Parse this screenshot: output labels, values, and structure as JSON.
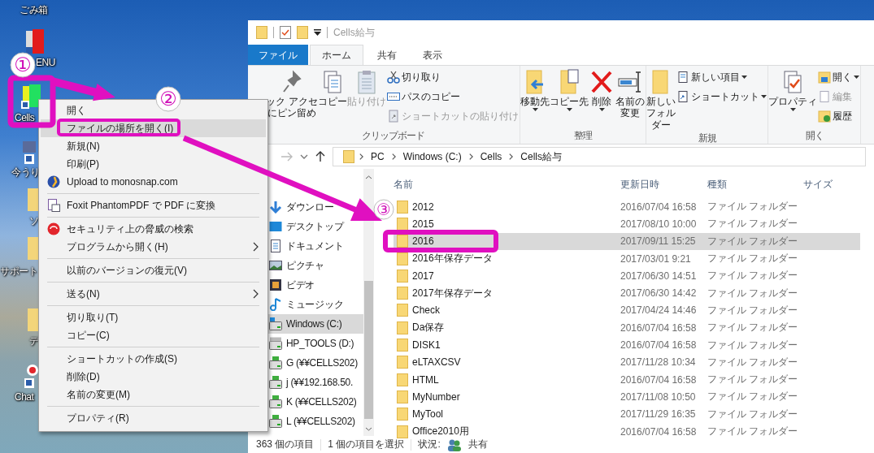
{
  "desktop": {
    "icons": [
      {
        "label": "ごみ箱",
        "kind": "label-only"
      },
      {
        "label": "ENU",
        "kind": "menu-app"
      },
      {
        "label": "Cells",
        "kind": "cells-app"
      },
      {
        "label": "今うり",
        "kind": "tool"
      },
      {
        "label": "ソ",
        "kind": "folder"
      },
      {
        "label": "サポート",
        "kind": "folder"
      },
      {
        "label": "デ",
        "kind": "folder"
      },
      {
        "label": "Chat",
        "kind": "chat-app"
      }
    ]
  },
  "explorer": {
    "title": "Cells給与",
    "tabs": [
      {
        "label": "ファイル",
        "kind": "file",
        "selected": false
      },
      {
        "label": "ホーム",
        "kind": "tab",
        "selected": true
      },
      {
        "label": "共有",
        "kind": "tab",
        "selected": false
      },
      {
        "label": "表示",
        "kind": "tab",
        "selected": false
      }
    ],
    "ribbon": {
      "groups": [
        {
          "label": "クリップボード",
          "large": [
            {
              "label": "ック アクセにピン留め",
              "disabled": false,
              "dropdown": false
            },
            {
              "label": "コピー",
              "disabled": false,
              "dropdown": false
            },
            {
              "label": "貼り付け",
              "disabled": true,
              "dropdown": false
            }
          ],
          "small": [
            {
              "label": "切り取り",
              "disabled": false,
              "dropdown": false
            },
            {
              "label": "パスのコピー",
              "disabled": false,
              "dropdown": false
            },
            {
              "label": "ショートカットの貼り付け",
              "disabled": true,
              "dropdown": false
            }
          ]
        },
        {
          "label": "整理",
          "large": [
            {
              "label": "移動先",
              "disabled": false,
              "dropdown": true
            },
            {
              "label": "コピー先",
              "disabled": false,
              "dropdown": true
            },
            {
              "label": "削除",
              "disabled": false,
              "dropdown": true
            },
            {
              "label": "名前の変更",
              "disabled": false,
              "dropdown": false
            }
          ]
        },
        {
          "label": "新規",
          "large": [
            {
              "label": "新しいフォルダー",
              "disabled": false,
              "dropdown": false
            }
          ],
          "small": [
            {
              "label": "新しい項目",
              "disabled": false,
              "dropdown": true
            },
            {
              "label": "ショートカット",
              "disabled": false,
              "dropdown": true
            }
          ]
        },
        {
          "label": "開く",
          "large": [
            {
              "label": "プロパティ",
              "disabled": false,
              "dropdown": true
            }
          ],
          "small": [
            {
              "label": "開く",
              "disabled": false,
              "dropdown": true
            },
            {
              "label": "編集",
              "disabled": true,
              "dropdown": false
            },
            {
              "label": "履歴",
              "disabled": false,
              "dropdown": false
            }
          ]
        }
      ]
    },
    "address": {
      "crumbs": [
        "PC",
        "Windows (C:)",
        "Cells",
        "Cells給与"
      ]
    },
    "nav": {
      "items": [
        {
          "label": "ダウンロー",
          "kind": "download",
          "selected": false
        },
        {
          "label": "デスクトップ",
          "kind": "desktop",
          "selected": false
        },
        {
          "label": "ドキュメント",
          "kind": "document",
          "selected": false
        },
        {
          "label": "ピクチャ",
          "kind": "picture",
          "selected": false
        },
        {
          "label": "ビデオ",
          "kind": "video",
          "selected": false
        },
        {
          "label": "ミュージック",
          "kind": "music",
          "selected": false
        },
        {
          "label": "Windows (C:)",
          "kind": "system-drive",
          "selected": true
        },
        {
          "label": "HP_TOOLS (D:)",
          "kind": "drive",
          "selected": false
        },
        {
          "label": "G (¥¥CELLS202)",
          "kind": "network-drive",
          "selected": false
        },
        {
          "label": "j (¥¥192.168.50.",
          "kind": "network-drive",
          "selected": false
        },
        {
          "label": "K (¥¥CELLS202)",
          "kind": "network-drive",
          "selected": false
        },
        {
          "label": "L (¥¥CELLS202)",
          "kind": "network-drive",
          "selected": false
        }
      ]
    },
    "files": {
      "columns": [
        "名前",
        "更新日時",
        "種類",
        "サイズ"
      ],
      "rows": [
        {
          "name": "2012",
          "modified": "2016/07/04 16:58",
          "type": "ファイル フォルダー",
          "selected": false
        },
        {
          "name": "2015",
          "modified": "2017/08/10 10:00",
          "type": "ファイル フォルダー",
          "selected": false
        },
        {
          "name": "2016",
          "modified": "2017/09/11 15:25",
          "type": "ファイル フォルダー",
          "selected": true
        },
        {
          "name": "2016年保存データ",
          "modified": "2017/03/01 9:21",
          "type": "ファイル フォルダー",
          "selected": false
        },
        {
          "name": "2017",
          "modified": "2017/06/30 14:51",
          "type": "ファイル フォルダー",
          "selected": false
        },
        {
          "name": "2017年保存データ",
          "modified": "2017/06/30 14:42",
          "type": "ファイル フォルダー",
          "selected": false
        },
        {
          "name": "Check",
          "modified": "2017/04/24 14:46",
          "type": "ファイル フォルダー",
          "selected": false
        },
        {
          "name": "Da保存",
          "modified": "2016/07/04 16:58",
          "type": "ファイル フォルダー",
          "selected": false
        },
        {
          "name": "DISK1",
          "modified": "2016/07/04 16:58",
          "type": "ファイル フォルダー",
          "selected": false
        },
        {
          "name": "eLTAXCSV",
          "modified": "2017/11/28 10:34",
          "type": "ファイル フォルダー",
          "selected": false
        },
        {
          "name": "HTML",
          "modified": "2016/07/04 16:58",
          "type": "ファイル フォルダー",
          "selected": false
        },
        {
          "name": "MyNumber",
          "modified": "2017/11/08 10:50",
          "type": "ファイル フォルダー",
          "selected": false
        },
        {
          "name": "MyTool",
          "modified": "2017/11/29 16:35",
          "type": "ファイル フォルダー",
          "selected": false
        },
        {
          "name": "Office2010用",
          "modified": "2016/07/04 16:58",
          "type": "ファイル フォルダー",
          "selected": false
        }
      ]
    },
    "status": {
      "item_count": "363 個の項目",
      "selection": "1 個の項目を選択",
      "state_label": "状況:",
      "state": "共有"
    }
  },
  "context_menu": {
    "items": [
      {
        "kind": "item",
        "label": "開く",
        "selected": false,
        "submenu": false
      },
      {
        "kind": "item",
        "label": "ファイルの場所を開く(I)",
        "selected": true,
        "submenu": false
      },
      {
        "kind": "item",
        "label": "新規(N)",
        "selected": false,
        "submenu": false
      },
      {
        "kind": "item",
        "label": "印刷(P)",
        "selected": false,
        "submenu": false
      },
      {
        "kind": "item",
        "label": "Upload to monosnap.com",
        "selected": false,
        "submenu": false
      },
      {
        "kind": "separator"
      },
      {
        "kind": "item",
        "label": "Foxit PhantomPDF で PDF に変換",
        "selected": false,
        "submenu": false
      },
      {
        "kind": "separator"
      },
      {
        "kind": "item",
        "label": "セキュリティ上の脅威の検索",
        "selected": false,
        "submenu": false
      },
      {
        "kind": "item",
        "label": "プログラムから開く(H)",
        "selected": false,
        "submenu": true
      },
      {
        "kind": "separator"
      },
      {
        "kind": "item",
        "label": "以前のバージョンの復元(V)",
        "selected": false,
        "submenu": false
      },
      {
        "kind": "separator"
      },
      {
        "kind": "item",
        "label": "送る(N)",
        "selected": false,
        "submenu": true
      },
      {
        "kind": "separator"
      },
      {
        "kind": "item",
        "label": "切り取り(T)",
        "selected": false,
        "submenu": false
      },
      {
        "kind": "item",
        "label": "コピー(C)",
        "selected": false,
        "submenu": false
      },
      {
        "kind": "separator"
      },
      {
        "kind": "item",
        "label": "ショートカットの作成(S)",
        "selected": false,
        "submenu": false
      },
      {
        "kind": "item",
        "label": "削除(D)",
        "selected": false,
        "submenu": false
      },
      {
        "kind": "item",
        "label": "名前の変更(M)",
        "selected": false,
        "submenu": false
      },
      {
        "kind": "separator"
      },
      {
        "kind": "item",
        "label": "プロパティ(R)",
        "selected": false,
        "submenu": false
      }
    ]
  },
  "annotations": {
    "markers": [
      "①",
      "②",
      "③"
    ]
  }
}
